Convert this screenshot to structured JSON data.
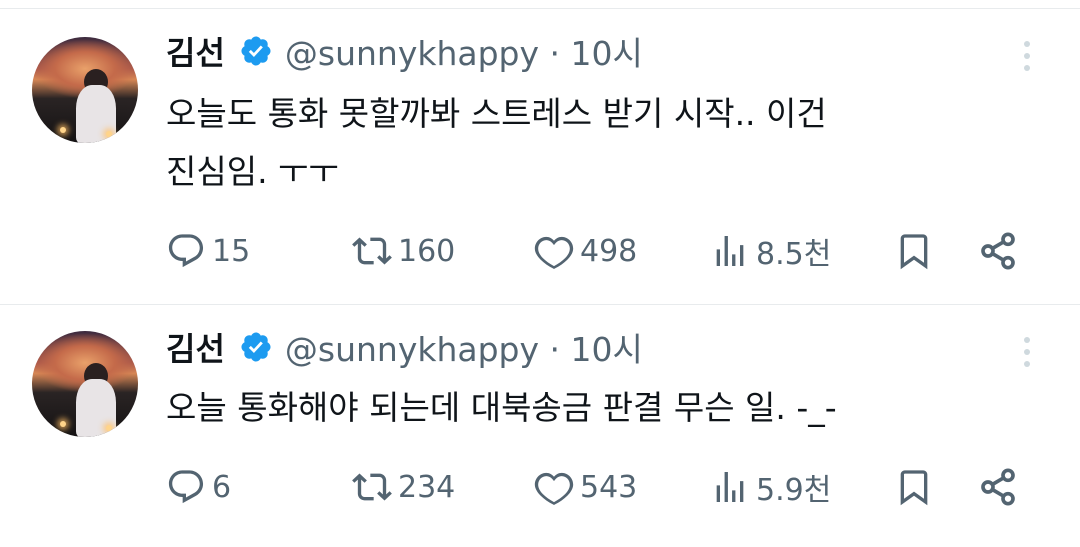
{
  "tweets": [
    {
      "name": "김선",
      "handle_time": "@sunnykhappy · 10시",
      "text_line1": "오늘도 통화 못할까봐 스트레스 받기 시작.. 이건",
      "text_line2": "진심임. ㅜㅜ",
      "replies": "15",
      "retweets": "160",
      "likes": "498",
      "views": "8.5천"
    },
    {
      "name": "김선",
      "handle_time": "@sunnykhappy · 10시",
      "text_line1": "오늘 통화해야 되는데 대북송금 판결 무슨 일. -_-",
      "replies": "6",
      "retweets": "234",
      "likes": "543",
      "views": "5.9천"
    }
  ],
  "colors": {
    "text": "#0f1419",
    "secondary": "#536471",
    "verified": "#1d9bf0",
    "divider": "#e8ebed"
  },
  "icons": [
    "reply-icon",
    "retweet-icon",
    "like-icon",
    "views-icon",
    "bookmark-icon",
    "share-icon",
    "more-icon",
    "verified-badge-icon"
  ]
}
